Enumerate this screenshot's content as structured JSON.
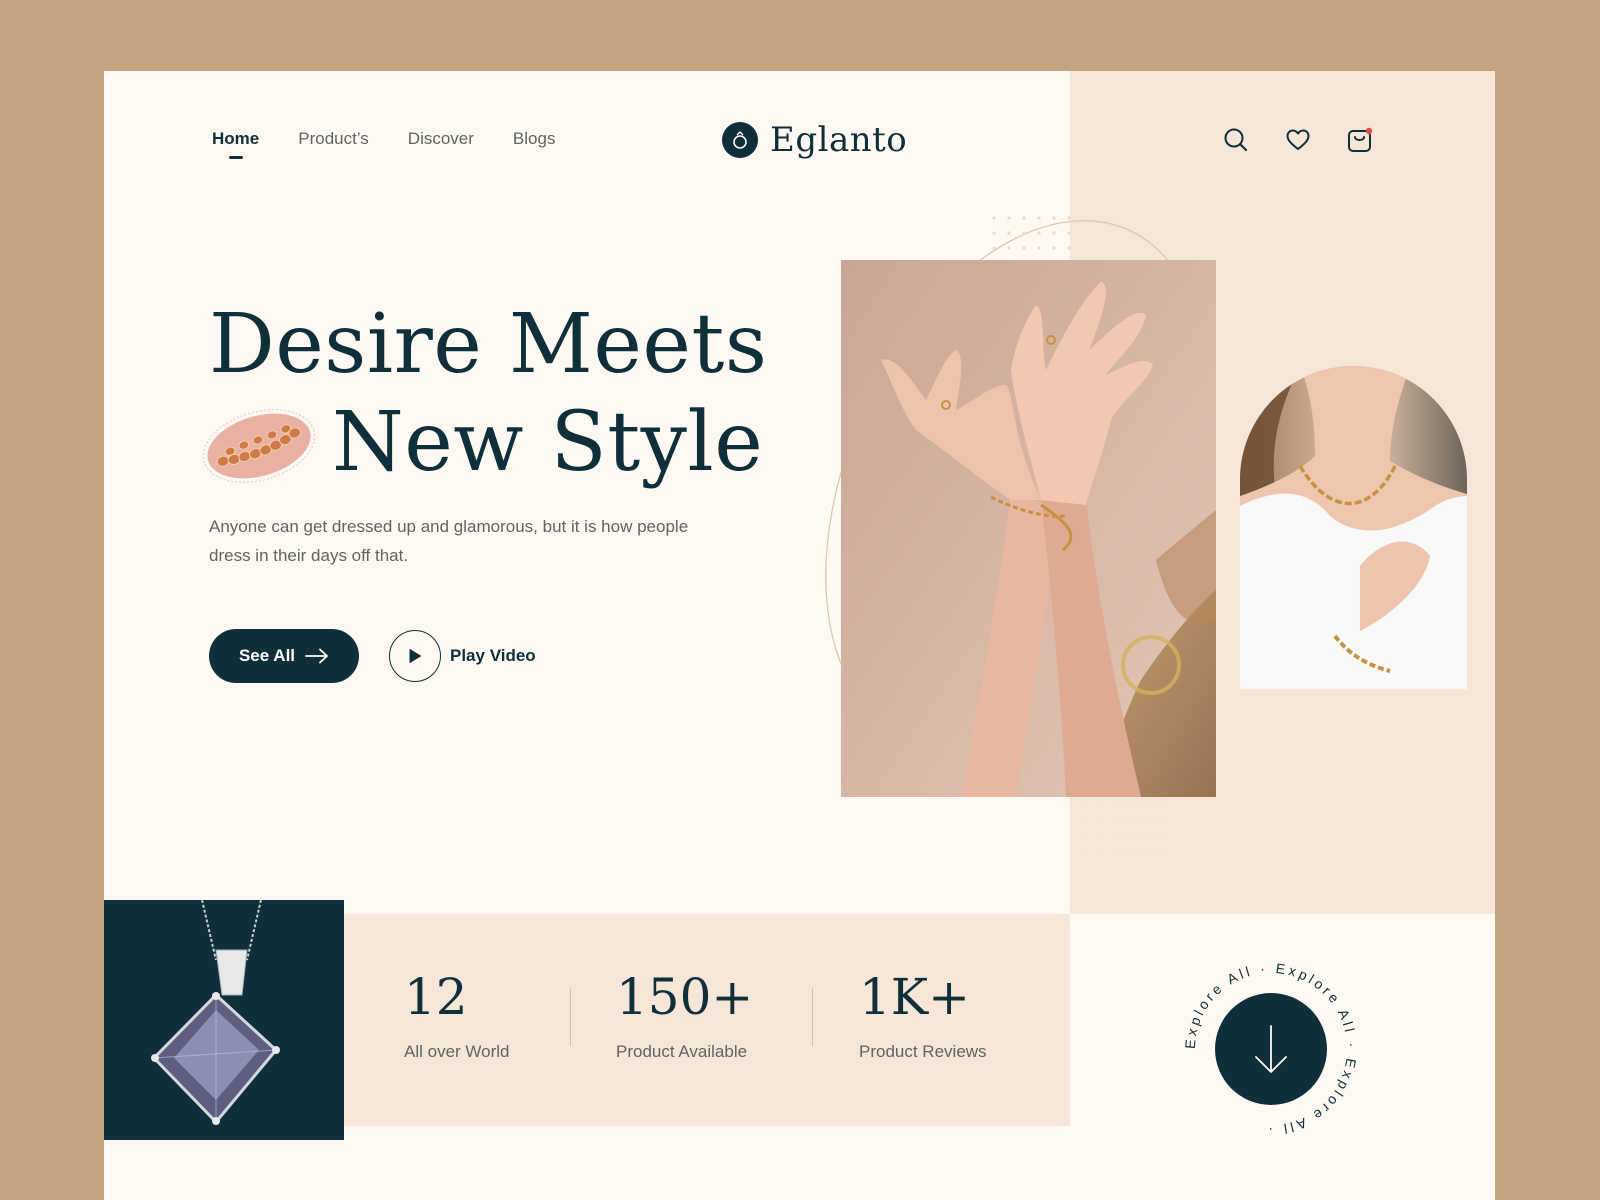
{
  "brand": {
    "name": "Eglanto"
  },
  "nav": {
    "items": [
      "Home",
      "Product’s",
      "Discover",
      "Blogs"
    ],
    "active": "Home"
  },
  "hero": {
    "headline_line1": "Desire Meets",
    "headline_line2": "New Style",
    "subtext": "Anyone can get dressed up and glamorous, but it is how people dress in their days off that.",
    "primary_cta": "See All",
    "secondary_cta": "Play Video"
  },
  "stats": [
    {
      "value": "12",
      "label": "All over World"
    },
    {
      "value": "150+",
      "label": "Product Available"
    },
    {
      "value": "1K+",
      "label": "Product Reviews"
    }
  ],
  "explore": {
    "ring_text": "Explore All · Explore All · Explore All ·"
  },
  "header_icons": [
    "search-icon",
    "heart-icon",
    "shopping-bag-icon"
  ],
  "colors": {
    "outer_background": "#c4a47f",
    "page_background": "#fef8f2",
    "accent_panel": "#f6e6d7",
    "primary_dark": "#0f2f3a",
    "muted_text": "#5f6466",
    "notification_dot": "#e0484b"
  }
}
